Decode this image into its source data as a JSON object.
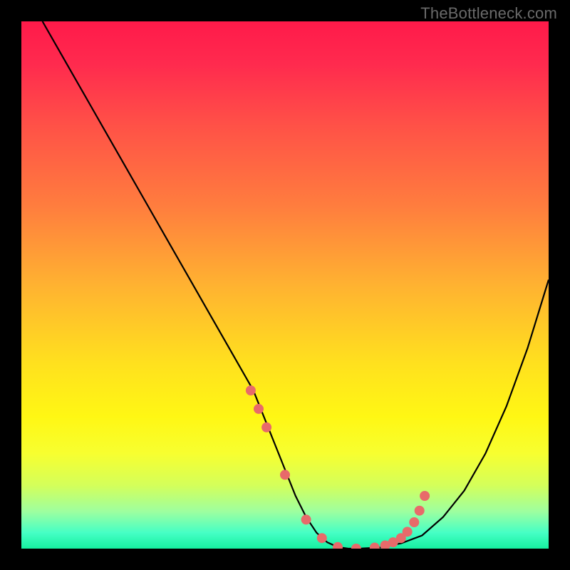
{
  "watermark": "TheBottleneck.com",
  "chart_data": {
    "type": "line",
    "title": "",
    "xlabel": "",
    "ylabel": "",
    "xlim": [
      0,
      100
    ],
    "ylim": [
      0,
      100
    ],
    "grid": false,
    "legend": false,
    "background_gradient": {
      "stops": [
        {
          "offset": 0.0,
          "color": "#ff1a4a"
        },
        {
          "offset": 0.08,
          "color": "#ff2a4e"
        },
        {
          "offset": 0.2,
          "color": "#ff5247"
        },
        {
          "offset": 0.35,
          "color": "#ff7d3e"
        },
        {
          "offset": 0.5,
          "color": "#ffb231"
        },
        {
          "offset": 0.65,
          "color": "#ffe11e"
        },
        {
          "offset": 0.75,
          "color": "#fff714"
        },
        {
          "offset": 0.82,
          "color": "#f7ff30"
        },
        {
          "offset": 0.88,
          "color": "#d4ff5a"
        },
        {
          "offset": 0.93,
          "color": "#9dffa0"
        },
        {
          "offset": 0.97,
          "color": "#45ffc5"
        },
        {
          "offset": 1.0,
          "color": "#16f0a0"
        }
      ]
    },
    "series": [
      {
        "name": "bottleneck-curve",
        "color": "#000000",
        "x": [
          4,
          8,
          12,
          16,
          20,
          24,
          28,
          32,
          36,
          40,
          44,
          48,
          50,
          52,
          54,
          56,
          58,
          60,
          62,
          64,
          68,
          72,
          76,
          80,
          84,
          88,
          92,
          96,
          100
        ],
        "y": [
          100,
          93,
          86,
          79,
          72,
          65,
          58,
          51,
          44,
          37,
          30,
          20,
          15,
          10,
          6,
          3,
          1.2,
          0.3,
          0,
          0,
          0.2,
          1.0,
          2.5,
          6,
          11,
          18,
          27,
          38,
          51
        ]
      },
      {
        "name": "optimum-markers",
        "color": "#e86a6a",
        "marker_radius": 7,
        "x": [
          43.5,
          45.0,
          46.5,
          50.0,
          54.0,
          57.0,
          60.0,
          63.5,
          67.0,
          69.0,
          70.5,
          72.0,
          73.2,
          74.5,
          75.5,
          76.5
        ],
        "y": [
          30.0,
          26.5,
          23.0,
          14.0,
          5.5,
          2.0,
          0.3,
          0.0,
          0.2,
          0.6,
          1.2,
          2.0,
          3.2,
          5.0,
          7.2,
          10.0
        ]
      }
    ]
  }
}
